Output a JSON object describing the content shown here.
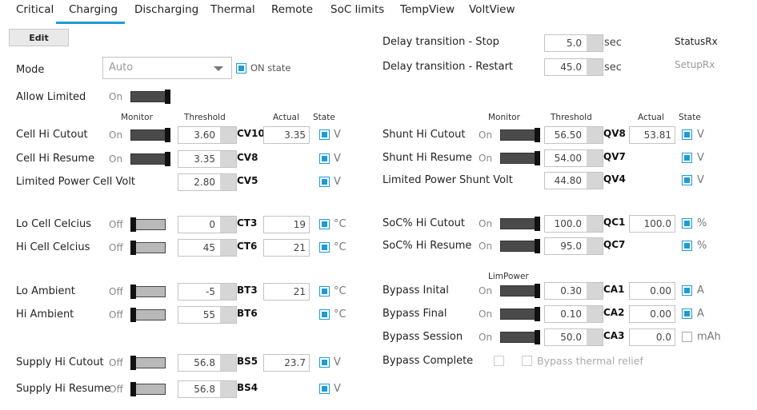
{
  "tabs": [
    "Critical",
    "Charging",
    "Discharging",
    "Thermal",
    "Remote",
    "SoC limits",
    "TempView",
    "VoltView"
  ],
  "active_tab": "Charging",
  "edit_label": "Edit",
  "mode": {
    "label": "Mode",
    "value": "Auto",
    "on_state_label": "ON state",
    "on_state_checked": true
  },
  "allow_limited": {
    "label": "Allow Limited",
    "state": "On"
  },
  "delay": {
    "stop_label": "Delay transition - Stop",
    "stop_value": "5.0",
    "stop_unit": "sec",
    "restart_label": "Delay transition - Restart",
    "restart_value": "45.0",
    "restart_unit": "sec"
  },
  "status_rx": "StatusRx",
  "setup_rx": "SetupRx",
  "headers": {
    "monitor": "Monitor",
    "threshold": "Threshold",
    "actual": "Actual",
    "state": "State",
    "limpower": "LimPower"
  },
  "left_rows": [
    {
      "label": "Cell Hi Cutout",
      "toggle": "On",
      "threshold": "3.60",
      "code": "CV10",
      "actual": "3.35",
      "state": true,
      "unit": "V"
    },
    {
      "label": "Cell Hi Resume",
      "toggle": "On",
      "threshold": "3.35",
      "code": "CV8",
      "actual": "",
      "state": true,
      "unit": "V"
    },
    {
      "label": "Limited Power Cell Volt",
      "toggle": "",
      "threshold": "2.80",
      "code": "CV5",
      "actual": "",
      "state": true,
      "unit": "V"
    },
    {
      "label": "Lo Cell Celcius",
      "toggle": "Off",
      "threshold": "0",
      "code": "CT3",
      "actual": "19",
      "state": true,
      "unit": "°C"
    },
    {
      "label": "Hi Cell Celcius",
      "toggle": "Off",
      "threshold": "45",
      "code": "CT6",
      "actual": "21",
      "state": true,
      "unit": "°C"
    },
    {
      "label": "Lo Ambient",
      "toggle": "Off",
      "threshold": "-5",
      "code": "BT3",
      "actual": "21",
      "state": true,
      "unit": "°C"
    },
    {
      "label": "Hi Ambient",
      "toggle": "Off",
      "threshold": "55",
      "code": "BT6",
      "actual": "",
      "state": true,
      "unit": "°C"
    },
    {
      "label": "Supply Hi Cutout",
      "toggle": "Off",
      "threshold": "56.8",
      "code": "BS5",
      "actual": "23.7",
      "state": true,
      "unit": "V"
    },
    {
      "label": "Supply Hi Resume",
      "toggle": "Off",
      "threshold": "56.8",
      "code": "BS4",
      "actual": "",
      "state": true,
      "unit": "V"
    }
  ],
  "right_rows": [
    {
      "label": "Shunt Hi Cutout",
      "toggle": "On",
      "threshold": "56.50",
      "code": "QV8",
      "actual": "53.81",
      "state": true,
      "unit": "V"
    },
    {
      "label": "Shunt Hi Resume",
      "toggle": "On",
      "threshold": "54.00",
      "code": "QV7",
      "actual": "",
      "state": true,
      "unit": "V"
    },
    {
      "label": "Limited Power Shunt Volt",
      "toggle": "",
      "threshold": "44.80",
      "code": "QV4",
      "actual": "",
      "state": true,
      "unit": "V"
    },
    {
      "label": "SoC% Hi Cutout",
      "toggle": "On",
      "threshold": "100.0",
      "code": "QC1",
      "actual": "100.0",
      "state": true,
      "unit": "%"
    },
    {
      "label": "SoC% Hi Resume",
      "toggle": "On",
      "threshold": "95.0",
      "code": "QC7",
      "actual": "",
      "state": true,
      "unit": "%"
    },
    {
      "label": "Bypass Inital",
      "toggle": "On",
      "threshold": "0.30",
      "code": "CA1",
      "actual": "0.00",
      "state": true,
      "unit": "A"
    },
    {
      "label": "Bypass Final",
      "toggle": "On",
      "threshold": "0.10",
      "code": "CA2",
      "actual": "0.00",
      "state": true,
      "unit": "A"
    },
    {
      "label": "Bypass Session",
      "toggle": "On",
      "threshold": "50.0",
      "code": "CA3",
      "actual": "0.0",
      "state": false,
      "unit": "mAh"
    }
  ],
  "bypass_complete": {
    "label": "Bypass Complete",
    "thermal_label": "Bypass thermal relief"
  }
}
